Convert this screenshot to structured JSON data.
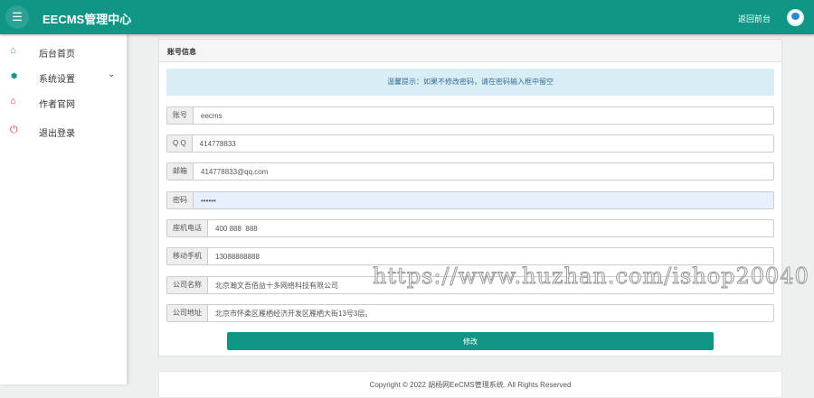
{
  "header": {
    "title": "EECMS管理中心",
    "back_link": "返回前台"
  },
  "sidebar": {
    "items": [
      {
        "label": "后台首页",
        "icon": "home-icon",
        "color": "#4caf50"
      },
      {
        "label": "系统设置",
        "icon": "gear-icon",
        "color": "#119585"
      },
      {
        "label": "作者官网",
        "icon": "home-icon",
        "color": "#e53935"
      },
      {
        "label": "退出登录",
        "icon": "power-icon",
        "color": "#e53935"
      }
    ]
  },
  "panel": {
    "title": "账号信息",
    "alert": "温馨提示：如果不修改密码，请在密码输入框中留空",
    "fields": [
      {
        "label": "账号",
        "value": "eecms"
      },
      {
        "label": "Q Q",
        "value": "414778833"
      },
      {
        "label": "邮箱",
        "value": "414778833@qq.com"
      },
      {
        "label": "密码",
        "value": "••••••"
      },
      {
        "label": "座机电话",
        "value": "400 888  888"
      },
      {
        "label": "移动手机",
        "value": "13088888888"
      },
      {
        "label": "公司名称",
        "value": "北京瀚文吾佰益十多网络科技有限公司"
      },
      {
        "label": "公司地址",
        "value": "北京市怀柔区雁栖经济开发区雁栖大街13号3层。"
      }
    ],
    "submit": "修改"
  },
  "footer": {
    "text": "Copyright © 2022 胡杨网EeCMS管理系统. All Rights Reserved"
  },
  "watermark": "https://www.huzhan.com/ishop20040"
}
